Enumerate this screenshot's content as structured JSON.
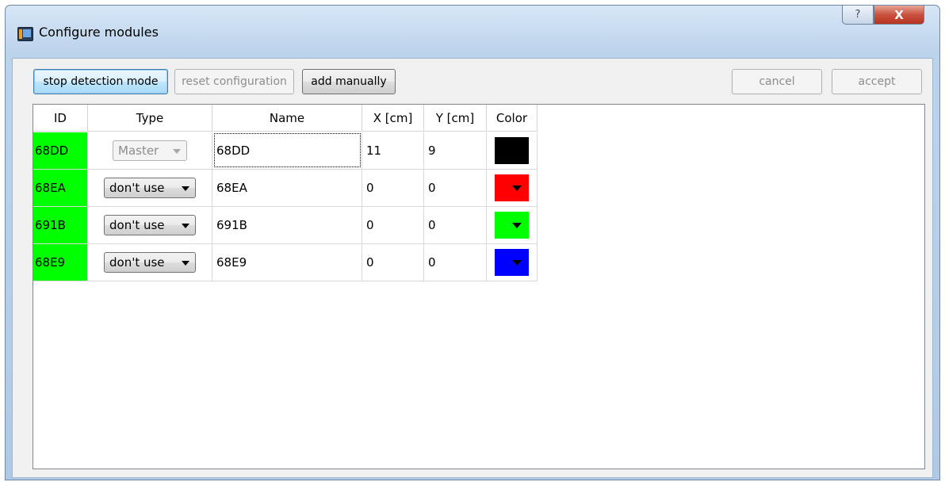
{
  "window": {
    "title": "Configure modules",
    "help_label": "?",
    "close_label": "X"
  },
  "toolbar": {
    "stop_detection_label": "stop detection mode",
    "reset_configuration_label": "reset configuration",
    "add_manually_label": "add manually",
    "cancel_label": "cancel",
    "accept_label": "accept"
  },
  "table": {
    "headers": [
      "ID",
      "Type",
      "Name",
      "X [cm]",
      "Y [cm]",
      "Color"
    ],
    "id_cell_color": "#00ff00",
    "rows": [
      {
        "id": "68DD",
        "type": "Master",
        "type_enabled": false,
        "name": "68DD",
        "x": "11",
        "y": "9",
        "color": "#000000",
        "color_dropdown": false
      },
      {
        "id": "68EA",
        "type": "don't use",
        "type_enabled": true,
        "name": "68EA",
        "x": "0",
        "y": "0",
        "color": "#ff0000",
        "color_dropdown": true
      },
      {
        "id": "691B",
        "type": "don't use",
        "type_enabled": true,
        "name": "691B",
        "x": "0",
        "y": "0",
        "color": "#00ff00",
        "color_dropdown": true
      },
      {
        "id": "68E9",
        "type": "don't use",
        "type_enabled": true,
        "name": "68E9",
        "x": "0",
        "y": "0",
        "color": "#0000ff",
        "color_dropdown": true
      }
    ]
  },
  "icons": {
    "app": "app-icon",
    "help": "help-icon",
    "close": "close-icon",
    "dropdown": "chevron-down-icon"
  }
}
